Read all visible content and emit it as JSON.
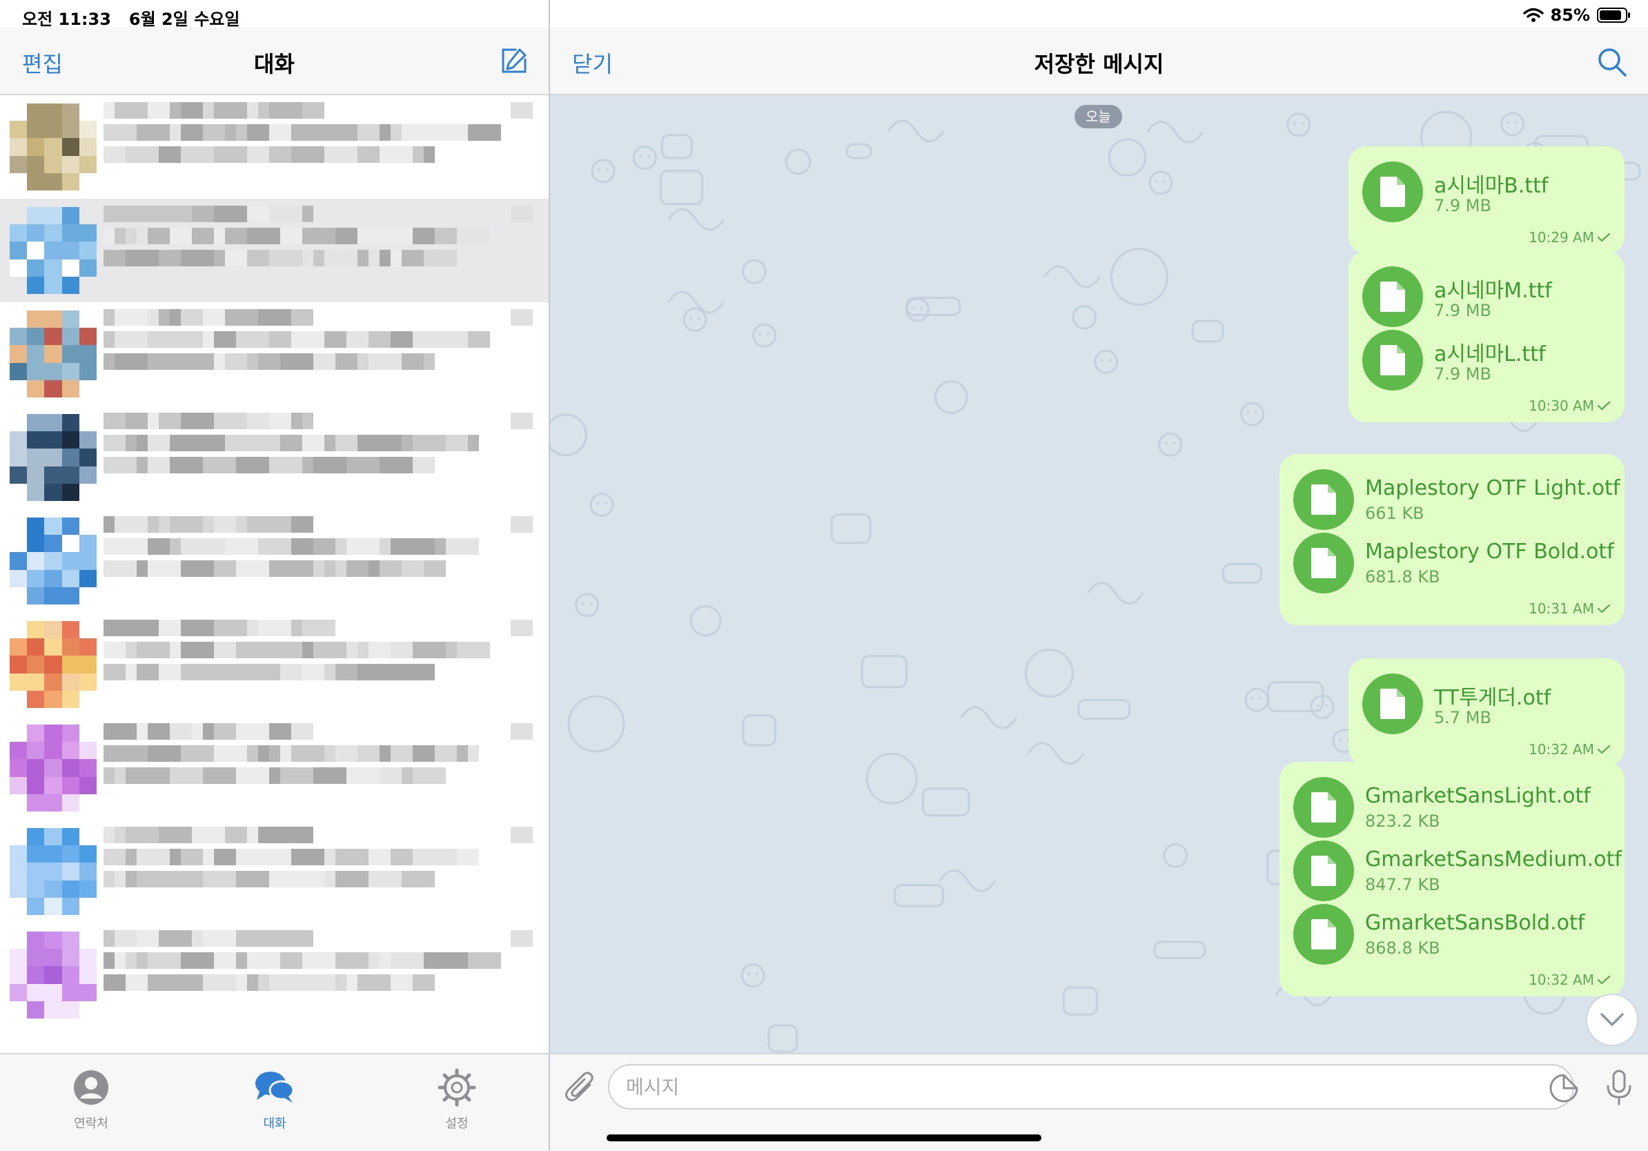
{
  "status_bar": {
    "time": "오전 11:33",
    "date": "6월 2일 수요일",
    "battery": "85%"
  },
  "chat_list": {
    "edit_label": "편집",
    "title": "대화",
    "compose_icon": "compose-icon"
  },
  "tabs": [
    {
      "label": "연락처",
      "icon": "contacts-icon",
      "active": false
    },
    {
      "label": "대화",
      "icon": "chats-icon",
      "active": true
    },
    {
      "label": "설정",
      "icon": "settings-icon",
      "active": false
    }
  ],
  "chat": {
    "close_label": "닫기",
    "title": "저장한 메시지",
    "search_icon": "search-icon",
    "date_label": "오늘",
    "messages": [
      {
        "files": [
          {
            "name": "a시네마B.ttf",
            "size": "7.9 MB"
          }
        ],
        "time": "10:29 AM"
      },
      {
        "files": [
          {
            "name": "a시네마M.ttf",
            "size": "7.9 MB"
          },
          {
            "name": "a시네마L.ttf",
            "size": "7.9 MB"
          }
        ],
        "time": "10:30 AM"
      },
      {
        "files": [
          {
            "name": "Maplestory OTF Light.otf",
            "size": "661 KB"
          },
          {
            "name": "Maplestory OTF Bold.otf",
            "size": "681.8 KB"
          }
        ],
        "time": "10:31 AM"
      },
      {
        "files": [
          {
            "name": "TT투게더.otf",
            "size": "5.7 MB"
          }
        ],
        "time": "10:32 AM"
      },
      {
        "files": [
          {
            "name": "GmarketSansLight.otf",
            "size": "823.2 KB"
          },
          {
            "name": "GmarketSansMedium.otf",
            "size": "847.7 KB"
          },
          {
            "name": "GmarketSansBold.otf",
            "size": "868.8 KB"
          }
        ],
        "time": "10:32 AM"
      }
    ]
  },
  "composer": {
    "placeholder": "메시지"
  },
  "colors": {
    "accent": "#2f7fd4",
    "bubble_out": "#e1fec6",
    "file_icon": "#5fba4c",
    "chat_background": "#d9e3ec"
  }
}
